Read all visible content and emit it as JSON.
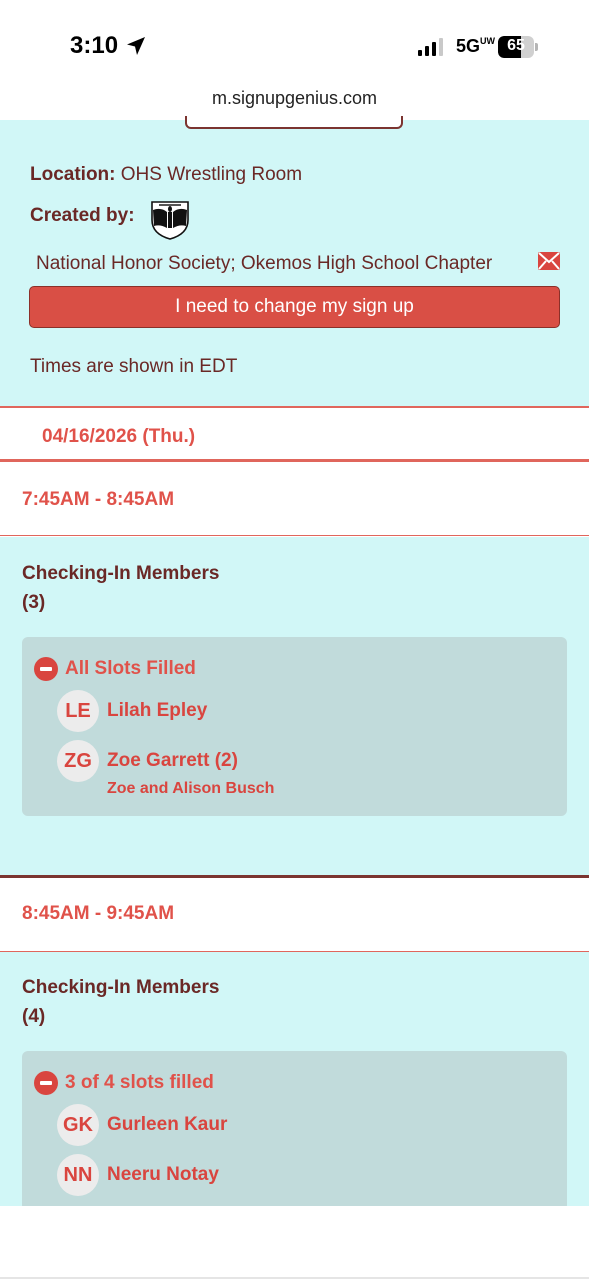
{
  "status_bar": {
    "time": "3:10",
    "network": "5G",
    "network_suffix": "UW",
    "battery": "65",
    "battery_level": 0.65
  },
  "browser": {
    "url": "m.signupgenius.com"
  },
  "info": {
    "location_label": "Location:",
    "location_value": "OHS Wrestling Room",
    "created_by_label": "Created by:",
    "organization": "National Honor Society; Okemos High School Chapter",
    "change_button": "I need to change my sign up",
    "timezone_note": "Times are shown in EDT"
  },
  "date": "04/16/2026 (Thu.)",
  "slots": [
    {
      "time": "7:45AM - 8:45AM",
      "title": "Checking-In Members",
      "count": "(3)",
      "status": "All Slots Filled",
      "people": [
        {
          "initials": "LE",
          "name": "Lilah Epley",
          "note": ""
        },
        {
          "initials": "ZG",
          "name": "Zoe Garrett (2)",
          "note": "Zoe and Alison Busch"
        }
      ]
    },
    {
      "time": "8:45AM - 9:45AM",
      "title": "Checking-In Members",
      "count": "(4)",
      "status": "3 of 4 slots filled",
      "people": [
        {
          "initials": "GK",
          "name": "Gurleen Kaur",
          "note": ""
        },
        {
          "initials": "NN",
          "name": "Neeru Notay",
          "note": ""
        }
      ]
    }
  ],
  "colors": {
    "panel_bg": "#d1f7f7",
    "accent_red": "#e0524a",
    "text_dark": "#6a2826",
    "slot_box": "#c1dbdb",
    "button_red": "#d94f45"
  },
  "icons": [
    "location-arrow-icon",
    "signal-icon",
    "battery-icon",
    "nhs-logo-icon",
    "mail-icon",
    "minus-circle-icon"
  ]
}
